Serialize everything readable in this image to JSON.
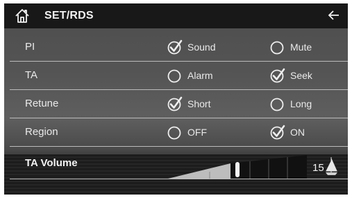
{
  "header": {
    "title": "SET/RDS",
    "home_icon": "home-icon",
    "back_icon": "back-arrow-icon"
  },
  "rows": [
    {
      "label": "PI",
      "options": [
        {
          "label": "Sound",
          "selected": true
        },
        {
          "label": "Mute",
          "selected": false
        }
      ]
    },
    {
      "label": "TA",
      "options": [
        {
          "label": "Alarm",
          "selected": false
        },
        {
          "label": "Seek",
          "selected": true
        }
      ]
    },
    {
      "label": "Retune",
      "options": [
        {
          "label": "Short",
          "selected": true
        },
        {
          "label": "Long",
          "selected": false
        }
      ]
    },
    {
      "label": "Region",
      "options": [
        {
          "label": "OFF",
          "selected": false
        },
        {
          "label": "ON",
          "selected": true
        }
      ]
    }
  ],
  "ta_volume": {
    "label": "TA Volume",
    "value": "15",
    "level": 0.5
  }
}
